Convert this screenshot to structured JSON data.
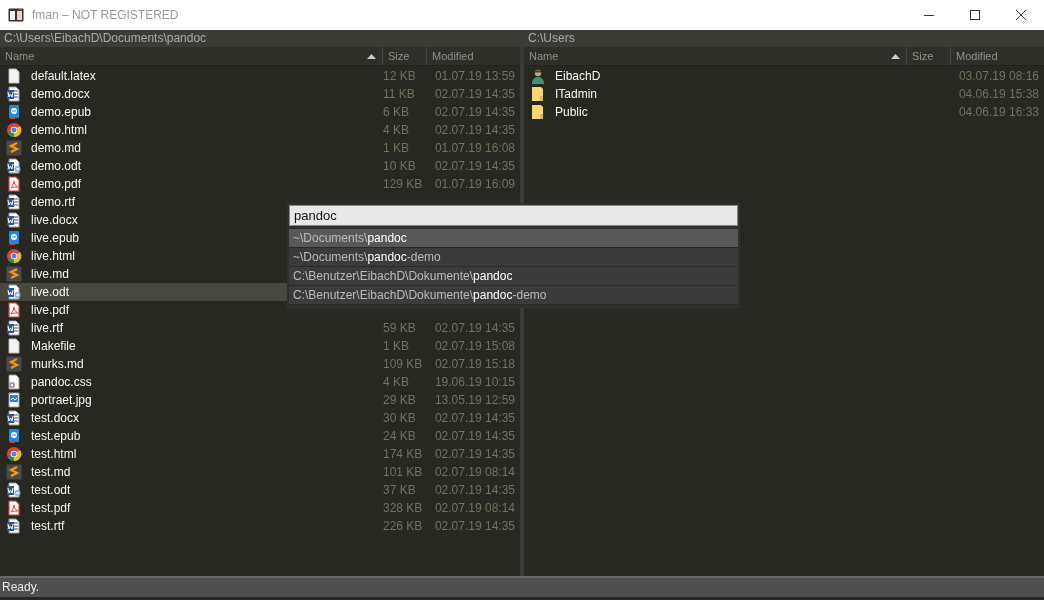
{
  "window": {
    "title": "fman – NOT REGISTERED"
  },
  "panes": [
    {
      "path": "C:\\Users\\EibachD\\Documents\\pandoc",
      "columns": [
        {
          "label": "Name",
          "sorted": true
        },
        {
          "label": "Size",
          "sorted": false
        },
        {
          "label": "Modified",
          "sorted": false
        }
      ],
      "rows": [
        {
          "name": "default.latex",
          "kind": "file",
          "size": "12 KB",
          "modified": "01.07.19 13:59",
          "selected": false
        },
        {
          "name": "demo.docx",
          "kind": "word",
          "size": "11 KB",
          "modified": "02.07.19 14:35",
          "selected": false
        },
        {
          "name": "demo.epub",
          "kind": "epub",
          "size": "6 KB",
          "modified": "02.07.19 14:35",
          "selected": false
        },
        {
          "name": "demo.html",
          "kind": "html",
          "size": "4 KB",
          "modified": "02.07.19 14:35",
          "selected": false
        },
        {
          "name": "demo.md",
          "kind": "md",
          "size": "1 KB",
          "modified": "01.07.19 16:08",
          "selected": false
        },
        {
          "name": "demo.odt",
          "kind": "odt",
          "size": "10 KB",
          "modified": "02.07.19 14:35",
          "selected": false
        },
        {
          "name": "demo.pdf",
          "kind": "pdf",
          "size": "129 KB",
          "modified": "01.07.19 16:09",
          "selected": false
        },
        {
          "name": "demo.rtf",
          "kind": "word",
          "selected": false
        },
        {
          "name": "live.docx",
          "kind": "word",
          "selected": false
        },
        {
          "name": "live.epub",
          "kind": "epub",
          "selected": false
        },
        {
          "name": "live.html",
          "kind": "html",
          "selected": false
        },
        {
          "name": "live.md",
          "kind": "md",
          "selected": false
        },
        {
          "name": "live.odt",
          "kind": "odt",
          "selected": true
        },
        {
          "name": "live.pdf",
          "kind": "pdf",
          "selected": false
        },
        {
          "name": "live.rtf",
          "kind": "word",
          "size": "59 KB",
          "modified": "02.07.19 14:35",
          "selected": false
        },
        {
          "name": "Makefile",
          "kind": "file",
          "size": "1 KB",
          "modified": "02.07.19 15:08",
          "selected": false
        },
        {
          "name": "murks.md",
          "kind": "md",
          "size": "109 KB",
          "modified": "02.07.19 15:18",
          "selected": false
        },
        {
          "name": "pandoc.css",
          "kind": "css",
          "size": "4 KB",
          "modified": "19.06.19 10:15",
          "selected": false
        },
        {
          "name": "portraet.jpg",
          "kind": "image",
          "size": "29 KB",
          "modified": "13.05.19 12:59",
          "selected": false
        },
        {
          "name": "test.docx",
          "kind": "word",
          "size": "30 KB",
          "modified": "02.07.19 14:35",
          "selected": false
        },
        {
          "name": "test.epub",
          "kind": "epub",
          "size": "24 KB",
          "modified": "02.07.19 14:35",
          "selected": false
        },
        {
          "name": "test.html",
          "kind": "html",
          "size": "174 KB",
          "modified": "02.07.19 14:35",
          "selected": false
        },
        {
          "name": "test.md",
          "kind": "md",
          "size": "101 KB",
          "modified": "02.07.19 08:14",
          "selected": false
        },
        {
          "name": "test.odt",
          "kind": "odt",
          "size": "37 KB",
          "modified": "02.07.19 14:35",
          "selected": false
        },
        {
          "name": "test.pdf",
          "kind": "pdf",
          "size": "328 KB",
          "modified": "02.07.19 08:14",
          "selected": false
        },
        {
          "name": "test.rtf",
          "kind": "word",
          "size": "226 KB",
          "modified": "02.07.19 14:35",
          "selected": false
        }
      ]
    },
    {
      "path": "C:\\Users",
      "columns": [
        {
          "label": "Name",
          "sorted": true
        },
        {
          "label": "Size",
          "sorted": false
        },
        {
          "label": "Modified",
          "sorted": false
        }
      ],
      "rows": [
        {
          "name": "EibachD",
          "kind": "user",
          "modified": "03.07.19 08:16",
          "selected": false
        },
        {
          "name": "ITadmin",
          "kind": "folder",
          "modified": "04.06.19 15:38",
          "selected": false
        },
        {
          "name": "Public",
          "kind": "folder",
          "modified": "04.06.19 16:33",
          "selected": false
        }
      ]
    }
  ],
  "quick_search": {
    "value": "pandoc",
    "suggestions": [
      {
        "text": "~\\Documents\\**pandoc**",
        "selected": true
      },
      {
        "text": "~\\Documents\\**pandoc**-demo",
        "selected": false
      },
      {
        "text": "C:\\Benutzer\\EibachD\\Dokumente\\**pandoc**",
        "selected": false
      },
      {
        "text": "C:\\Benutzer\\EibachD\\Dokumente\\**pandoc**-demo",
        "selected": false
      }
    ]
  },
  "status_bar": {
    "text": "Ready."
  }
}
